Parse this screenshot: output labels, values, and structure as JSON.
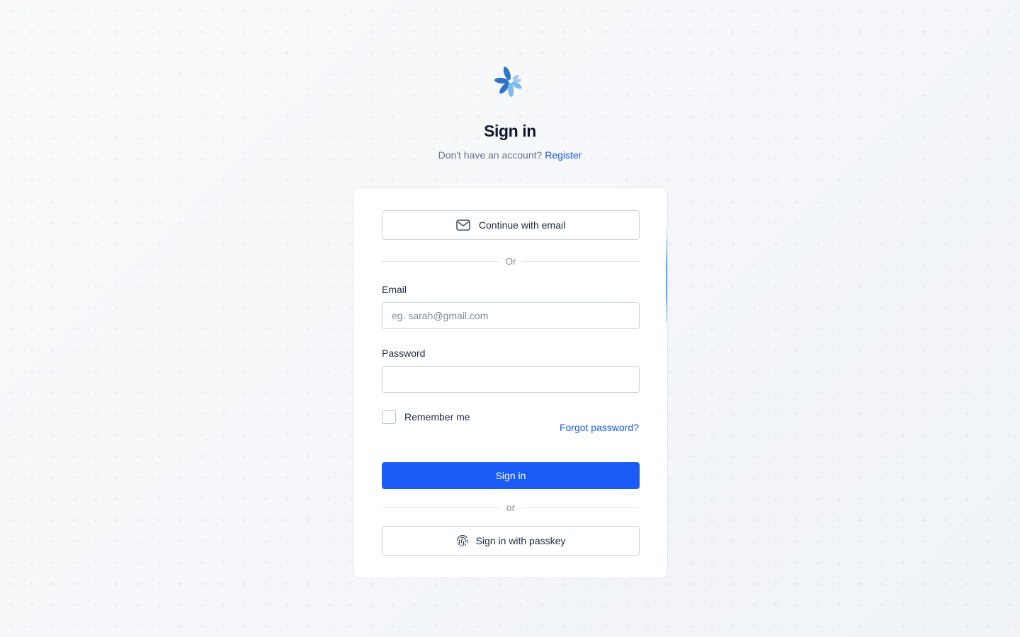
{
  "brand": {
    "logo_icon": "flower-logo-icon",
    "colors": {
      "dark_petal": "#2f74c8",
      "light_petal": "#7bbbee"
    }
  },
  "header": {
    "title": "Sign in",
    "subtitle_prefix": "Don't have an account?",
    "register_link": "Register"
  },
  "form": {
    "email_button_label": "Continue with email",
    "email_button_icon": "mail-icon",
    "divider_top": "Or",
    "email_label": "Email",
    "email_placeholder": "eg. sarah@gmail.com",
    "email_value": "",
    "password_label": "Password",
    "password_value": "",
    "remember_label": "Remember me",
    "remember_checked": false,
    "forgot_link": "Forgot password?",
    "submit_label": "Sign in",
    "divider_bottom": "or",
    "passkey_button_label": "Sign in with passkey",
    "passkey_button_icon": "fingerprint-icon"
  },
  "colors": {
    "accent": "#1a5cf5",
    "text_primary": "#0f172a",
    "text_muted": "#64748b",
    "border": "#cdd3dc"
  }
}
